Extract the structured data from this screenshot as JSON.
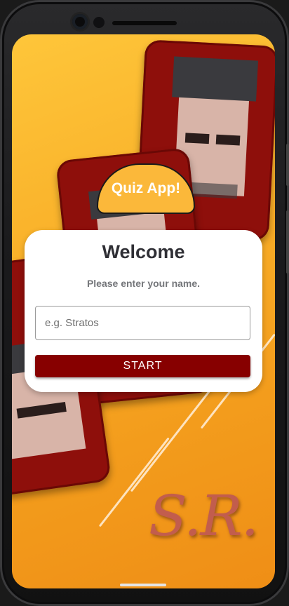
{
  "app": {
    "title_badge": "Quiz App!"
  },
  "welcome_card": {
    "title": "Welcome",
    "subtitle": "Please enter your name.",
    "name_input": {
      "value": "",
      "placeholder": "e.g. Stratos"
    },
    "start_button_label": "START"
  },
  "background": {
    "signature": "S.R.",
    "gradient_colors": [
      "#fec63a",
      "#ef8e16"
    ],
    "card_frame_color": "#8e0f0b"
  },
  "colors": {
    "accent": "#870000",
    "badge": "#fbb83a",
    "title_text": "#2f2f35",
    "subtitle_text": "#74767a"
  }
}
